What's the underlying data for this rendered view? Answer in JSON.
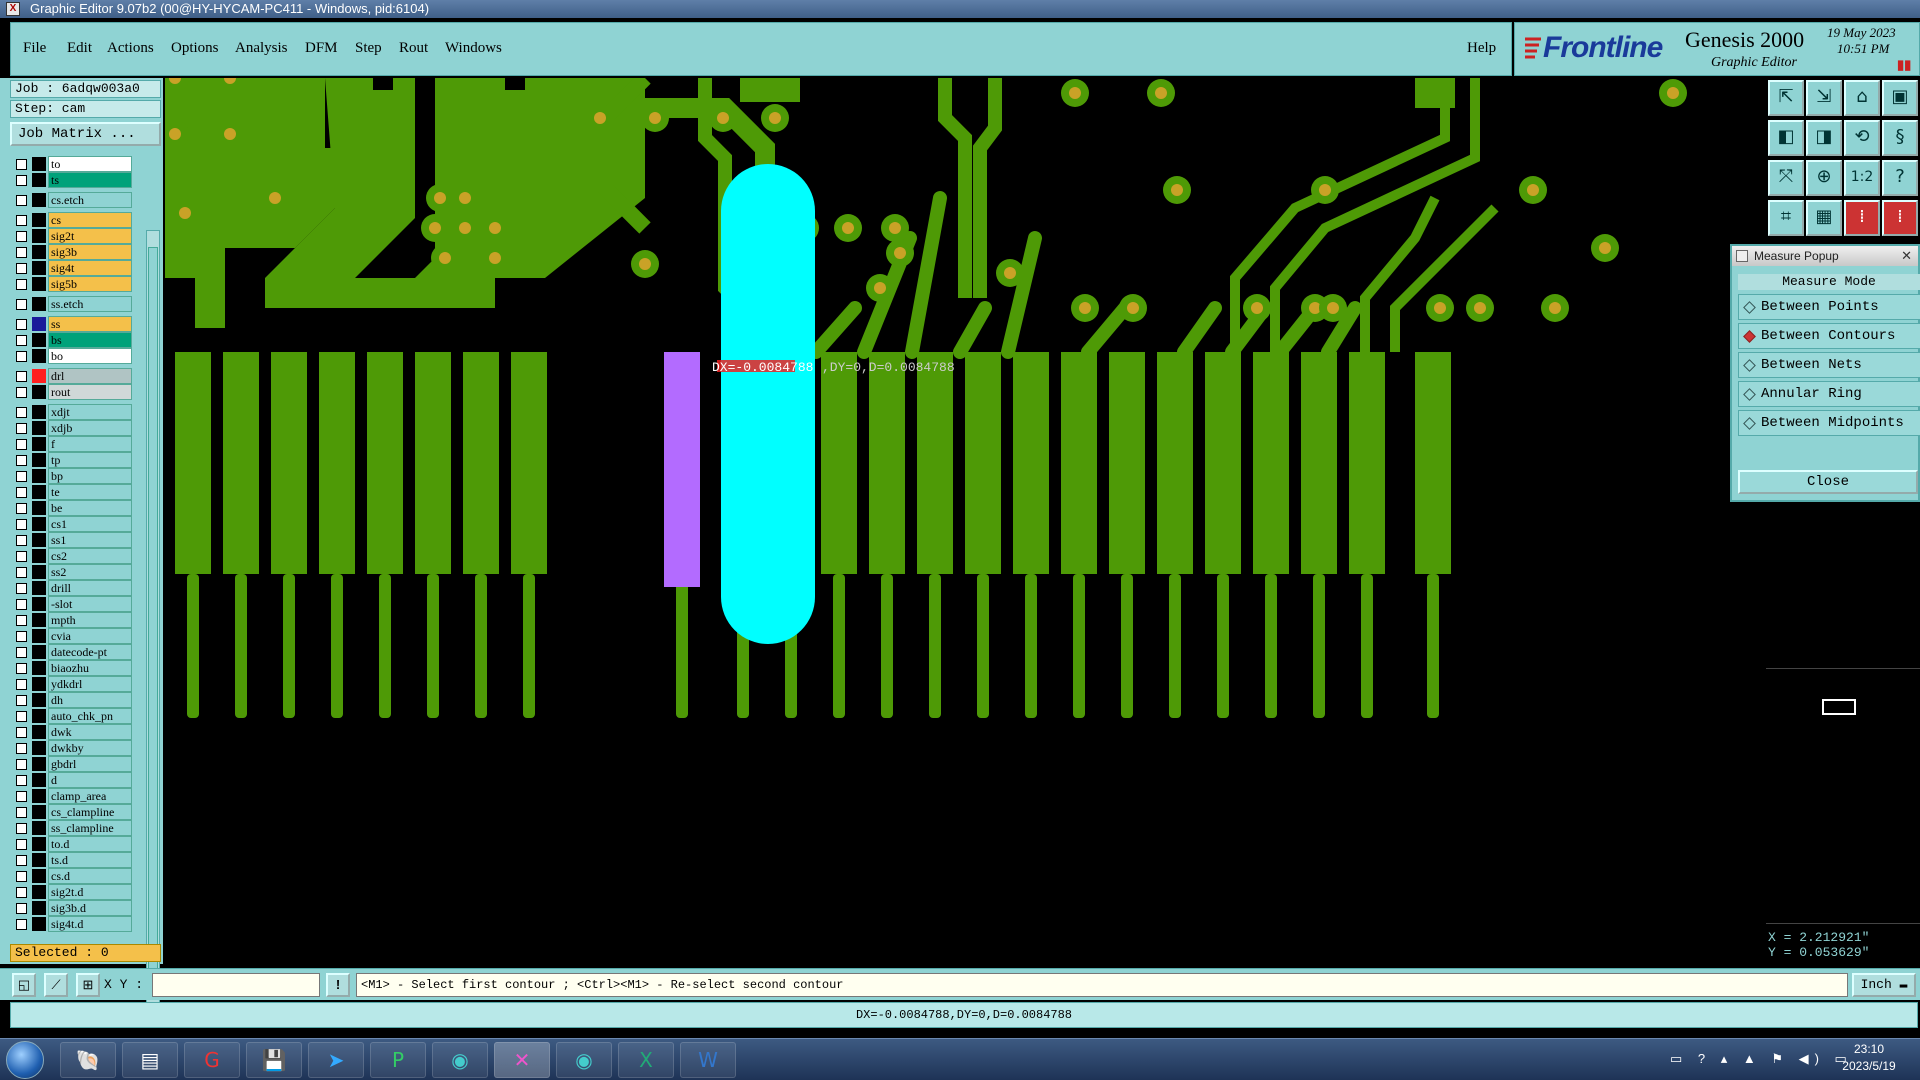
{
  "window": {
    "title": "Graphic Editor 9.07b2 (00@HY-HYCAM-PC411 - Windows, pid:6104)"
  },
  "menu": {
    "items": [
      "File",
      "Edit",
      "Actions",
      "Options",
      "Analysis",
      "DFM",
      "Step",
      "Rout",
      "Windows"
    ],
    "help": "Help"
  },
  "branding": {
    "logo": "Frontline",
    "product": "Genesis 2000",
    "subtitle": "Graphic Editor",
    "date": "19 May 2023",
    "time": "10:51 PM"
  },
  "job": {
    "job_label": "Job : 6adqw003a0",
    "step_label": "Step: cam",
    "matrix_button": "Job Matrix ..."
  },
  "layers": [
    {
      "name": "to",
      "color": "#ffffff"
    },
    {
      "name": "ts",
      "color": "#00a27a"
    },
    {
      "name": "cs.etch",
      "color": "#8fd3d3"
    },
    {
      "name": "cs",
      "color": "#f4c04a"
    },
    {
      "name": "sig2t",
      "color": "#f4c04a"
    },
    {
      "name": "sig3b",
      "color": "#f4c04a"
    },
    {
      "name": "sig4t",
      "color": "#f4c04a"
    },
    {
      "name": "sig5b",
      "color": "#f4c04a"
    },
    {
      "name": "ss.etch",
      "color": "#8fd3d3"
    },
    {
      "name": "ss",
      "color": "#f4c04a",
      "active": true
    },
    {
      "name": "bs",
      "color": "#00a27a"
    },
    {
      "name": "bo",
      "color": "#ffffff"
    },
    {
      "name": "drl",
      "color": "#b0c4c4",
      "swatch": "#ff2020"
    },
    {
      "name": "rout",
      "color": "#d0d8d8"
    },
    {
      "name": "xdjt",
      "color": "#8fd3d3"
    },
    {
      "name": "xdjb",
      "color": "#8fd3d3"
    },
    {
      "name": "f",
      "color": "#8fd3d3"
    },
    {
      "name": "tp",
      "color": "#8fd3d3"
    },
    {
      "name": "bp",
      "color": "#8fd3d3"
    },
    {
      "name": "te",
      "color": "#8fd3d3"
    },
    {
      "name": "be",
      "color": "#8fd3d3"
    },
    {
      "name": "cs1",
      "color": "#8fd3d3"
    },
    {
      "name": "ss1",
      "color": "#8fd3d3"
    },
    {
      "name": "cs2",
      "color": "#8fd3d3"
    },
    {
      "name": "ss2",
      "color": "#8fd3d3"
    },
    {
      "name": "drill",
      "color": "#8fd3d3"
    },
    {
      "name": "-slot",
      "color": "#8fd3d3"
    },
    {
      "name": "mpth",
      "color": "#8fd3d3"
    },
    {
      "name": "cvia",
      "color": "#8fd3d3"
    },
    {
      "name": "datecode-pt",
      "color": "#8fd3d3"
    },
    {
      "name": "biaozhu",
      "color": "#8fd3d3"
    },
    {
      "name": "ydkdrl",
      "color": "#8fd3d3"
    },
    {
      "name": "dh",
      "color": "#8fd3d3"
    },
    {
      "name": "auto_chk_pn",
      "color": "#8fd3d3"
    },
    {
      "name": "dwk",
      "color": "#8fd3d3"
    },
    {
      "name": "dwkby",
      "color": "#8fd3d3"
    },
    {
      "name": "gbdrl",
      "color": "#8fd3d3"
    },
    {
      "name": "d",
      "color": "#8fd3d3"
    },
    {
      "name": "clamp_area",
      "color": "#8fd3d3"
    },
    {
      "name": "cs_clampline",
      "color": "#8fd3d3"
    },
    {
      "name": "ss_clampline",
      "color": "#8fd3d3"
    },
    {
      "name": "to.d",
      "color": "#8fd3d3"
    },
    {
      "name": "ts.d",
      "color": "#8fd3d3"
    },
    {
      "name": "cs.d",
      "color": "#8fd3d3"
    },
    {
      "name": "sig2t.d",
      "color": "#8fd3d3"
    },
    {
      "name": "sig3b.d",
      "color": "#8fd3d3"
    },
    {
      "name": "sig4t.d",
      "color": "#8fd3d3"
    }
  ],
  "selected_label": "Selected : 0",
  "canvas": {
    "measure_label_dx": "DX=-0.0084788",
    "measure_label_rest": ",DY=0,D=0.0084788",
    "colors": {
      "copper": "#4e9a06",
      "pad": "#c9a227",
      "slot": "#00ffff",
      "selected": "#b36bff",
      "background": "#000000"
    }
  },
  "measure_popup": {
    "title": "Measure Popup",
    "mode_header": "Measure Mode",
    "options": [
      {
        "label": "Between Points",
        "selected": false
      },
      {
        "label": "Between Contours",
        "selected": true
      },
      {
        "label": "Between Nets",
        "selected": false
      },
      {
        "label": "Annular Ring",
        "selected": false
      },
      {
        "label": "Between Midpoints",
        "selected": false
      }
    ],
    "close_label": "Close"
  },
  "coords": {
    "x": "X = 2.212921\"",
    "y": "Y = 0.053629\""
  },
  "command_bar": {
    "xy_label": "X Y :",
    "xy_value": "",
    "prompt": "<M1> - Select first contour ; <Ctrl><M1> - Re-select second contour",
    "unit": "Inch"
  },
  "status_text": "DX=-0.0084788,DY=0,D=0.0084788",
  "taskbar": {
    "time": "23:10",
    "date": "2023/5/19"
  }
}
